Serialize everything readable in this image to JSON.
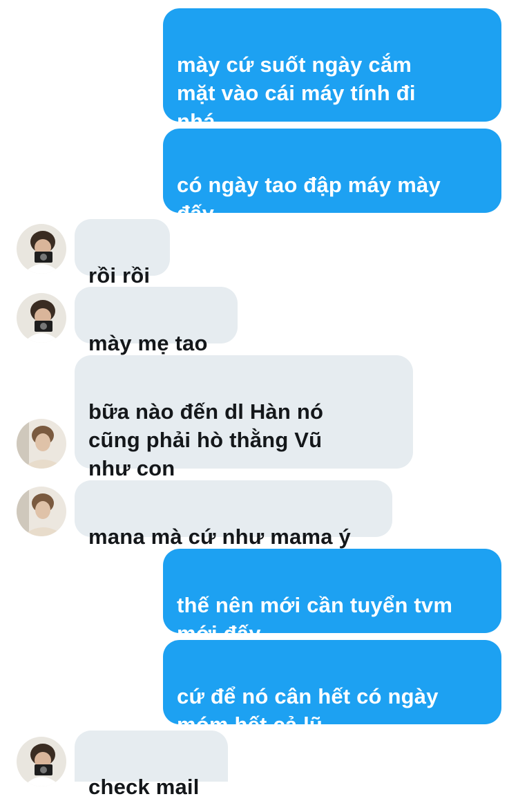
{
  "messages": [
    {
      "direction": "outgoing",
      "text": "mày cứ suốt ngày cắm\nmặt vào cái máy tính đi\nnhá"
    },
    {
      "direction": "outgoing",
      "text": "có ngày tao đập máy mày\nđấy"
    },
    {
      "direction": "incoming",
      "text": "rồi rồi",
      "avatar": "avatar-camera-icon"
    },
    {
      "direction": "incoming",
      "text": "mày mẹ tao",
      "avatar": "avatar-camera-icon"
    },
    {
      "direction": "incoming",
      "text": "bữa nào đến dl Hàn nó\ncũng phải hò thằng Vũ\nnhư con",
      "avatar": "avatar-selfie-icon"
    },
    {
      "direction": "incoming",
      "text": "mana mà cứ như mama ý",
      "avatar": "avatar-selfie-icon"
    },
    {
      "direction": "outgoing",
      "text": "thế nên mới cần tuyển tvm\nmới đấy"
    },
    {
      "direction": "outgoing",
      "text": "cứ để nó cân hết có ngày\nmóm hết cả lũ"
    },
    {
      "direction": "incoming",
      "text": "check mail",
      "avatar": "avatar-camera-icon"
    }
  ],
  "colors": {
    "outgoing_bubble": "#1da1f2",
    "incoming_bubble": "#e6ecf0",
    "incoming_text": "#14171a"
  }
}
